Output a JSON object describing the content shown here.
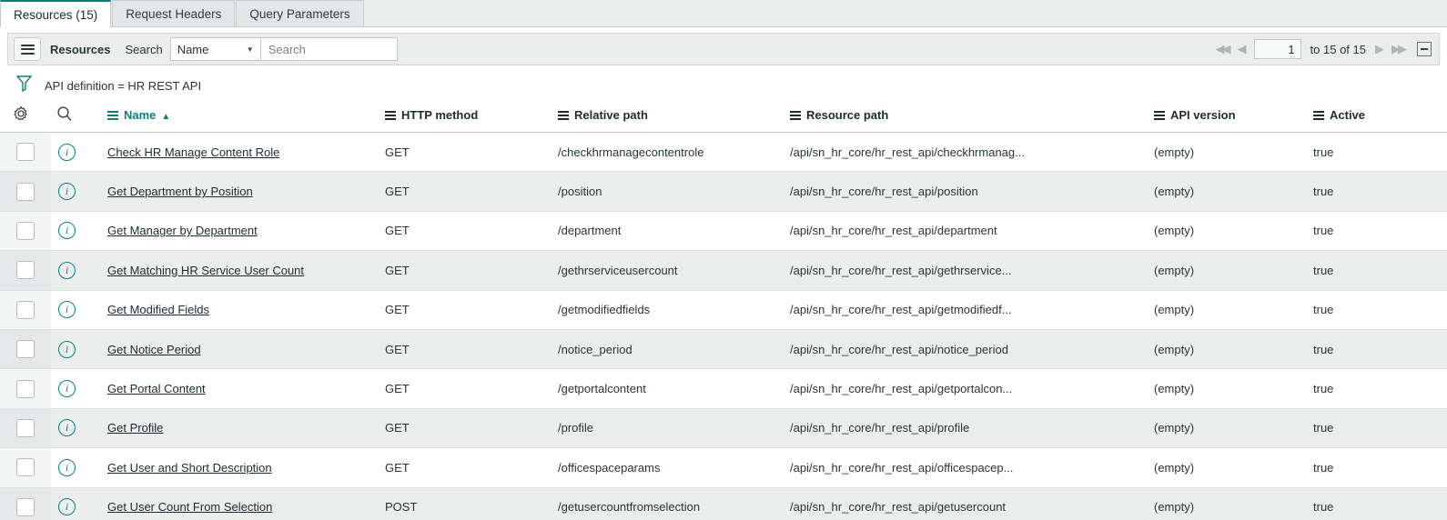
{
  "tabs": [
    {
      "label": "Resources (15)",
      "active": true
    },
    {
      "label": "Request Headers",
      "active": false
    },
    {
      "label": "Query Parameters",
      "active": false
    }
  ],
  "toolbar": {
    "menu_icon": "hamburger-icon",
    "title": "Resources",
    "search_label": "Search",
    "search_field_selected": "Name",
    "search_placeholder": "Search",
    "search_value": ""
  },
  "pagination": {
    "first_icon": "double-left-arrow-icon",
    "prev_icon": "left-arrow-icon",
    "page_value": "1",
    "range_text": "to 15 of 15",
    "next_icon": "right-arrow-icon",
    "last_icon": "double-right-arrow-icon",
    "minimize_icon": "minimize-icon"
  },
  "filter": {
    "icon": "funnel-icon",
    "text": "API definition = HR REST API"
  },
  "table": {
    "personalize_icon": "gear-icon",
    "search_icon": "magnifier-icon",
    "columns": [
      {
        "label": "Name",
        "sorted": true,
        "sort_dir": "asc"
      },
      {
        "label": "HTTP method",
        "sorted": false
      },
      {
        "label": "Relative path",
        "sorted": false
      },
      {
        "label": "Resource path",
        "sorted": false
      },
      {
        "label": "API version",
        "sorted": false
      },
      {
        "label": "Active",
        "sorted": false
      }
    ],
    "rows": [
      {
        "name": "Check HR Manage Content Role",
        "method": "GET",
        "relative_path": "/checkhrmanagecontentrole",
        "resource_path": "/api/sn_hr_core/hr_rest_api/checkhrmanag...",
        "api_version": "(empty)",
        "active": "true"
      },
      {
        "name": "Get Department by Position",
        "method": "GET",
        "relative_path": "/position",
        "resource_path": "/api/sn_hr_core/hr_rest_api/position",
        "api_version": "(empty)",
        "active": "true"
      },
      {
        "name": "Get Manager by Department",
        "method": "GET",
        "relative_path": "/department",
        "resource_path": "/api/sn_hr_core/hr_rest_api/department",
        "api_version": "(empty)",
        "active": "true"
      },
      {
        "name": "Get Matching HR Service User Count",
        "method": "GET",
        "relative_path": "/gethrserviceusercount",
        "resource_path": "/api/sn_hr_core/hr_rest_api/gethrservice...",
        "api_version": "(empty)",
        "active": "true"
      },
      {
        "name": "Get Modified Fields",
        "method": "GET",
        "relative_path": "/getmodifiedfields",
        "resource_path": "/api/sn_hr_core/hr_rest_api/getmodifiedf...",
        "api_version": "(empty)",
        "active": "true"
      },
      {
        "name": "Get Notice Period",
        "method": "GET",
        "relative_path": "/notice_period",
        "resource_path": "/api/sn_hr_core/hr_rest_api/notice_period",
        "api_version": "(empty)",
        "active": "true"
      },
      {
        "name": "Get Portal Content",
        "method": "GET",
        "relative_path": "/getportalcontent",
        "resource_path": "/api/sn_hr_core/hr_rest_api/getportalcon...",
        "api_version": "(empty)",
        "active": "true"
      },
      {
        "name": "Get Profile",
        "method": "GET",
        "relative_path": "/profile",
        "resource_path": "/api/sn_hr_core/hr_rest_api/profile",
        "api_version": "(empty)",
        "active": "true"
      },
      {
        "name": "Get User and Short Description",
        "method": "GET",
        "relative_path": "/officespaceparams",
        "resource_path": "/api/sn_hr_core/hr_rest_api/officespacep...",
        "api_version": "(empty)",
        "active": "true"
      },
      {
        "name": "Get User Count From Selection",
        "method": "POST",
        "relative_path": "/getusercountfromselection",
        "resource_path": "/api/sn_hr_core/hr_rest_api/getusercount",
        "api_version": "(empty)",
        "active": "true"
      }
    ]
  },
  "colors": {
    "accent": "#0b7f7a",
    "text": "#2b3437",
    "row_alt": "#eceded",
    "border": "#dfe2e3"
  }
}
